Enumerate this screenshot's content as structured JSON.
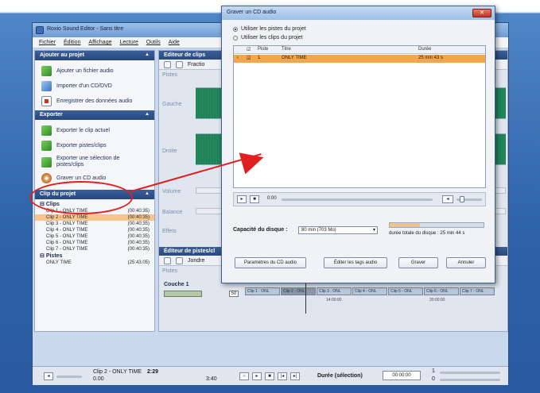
{
  "main_window": {
    "title": "Roxio Sound Editor - Sans titre",
    "menu": [
      "Fichier",
      "Édition",
      "Affichage",
      "Lecture",
      "Outils",
      "Aide"
    ],
    "project_section": {
      "title": "Ajouter au projet",
      "items": [
        "Ajouter un fichier audio",
        "Importer d'un CD/DVD",
        "Enregistrer des données audio"
      ]
    },
    "export_section": {
      "title": "Exporter",
      "items": [
        "Exporter le clip actuel",
        "Exporter pistes/clips",
        "Exporter une sélection de pistes/clips",
        "Graver un CD audio"
      ]
    },
    "project_tree": {
      "title": "Clip du projet",
      "clips_label": "Clips",
      "clips": [
        {
          "name": "Clip 1 - ONLY TIME",
          "time": "(00:40:35)"
        },
        {
          "name": "Clip 2 - ONLY TIME",
          "time": "(00:40:35)"
        },
        {
          "name": "Clip 3 - ONLY TIME",
          "time": "(00:40:35)"
        },
        {
          "name": "Clip 4 - ONLY TIME",
          "time": "(00:40:35)"
        },
        {
          "name": "Clip 5 - ONLY TIME",
          "time": "(00:40:35)"
        },
        {
          "name": "Clip 6 - ONLY TIME",
          "time": "(00:40:35)"
        },
        {
          "name": "Clip 7 - ONLY TIME",
          "time": "(00:40:35)"
        }
      ],
      "selected_clip_index": 1,
      "tracks_label": "Pistes",
      "tracks": [
        {
          "name": "ONLY TIME",
          "time": "(25:43.05)"
        }
      ]
    },
    "clip_editor": {
      "title": "Editeur de clips",
      "tool_label": "Fractio",
      "track_names": [
        "Pistes",
        "Gauche",
        "Droite",
        "Volume",
        "Balance",
        "Effets"
      ]
    },
    "track_editor": {
      "title": "Éditeur de pistes/cl",
      "tool_label": "Jondre",
      "track_header": "Pistes",
      "layer_label": "Couche 1",
      "layer_value": "50",
      "clips": [
        "Clip 1 - ONL",
        "Clip 2 - ONL",
        "Clip 3 - ONL",
        "Clip 4 - ONL",
        "Clip 5 - ONL",
        "Clip 6 - ONL",
        "Clip 7 - ONL"
      ],
      "ruler": [
        "14:00:00",
        "20:00:00"
      ]
    },
    "status": {
      "clip_name": "Clip 2 - ONLY TIME",
      "clip_time": "2:29",
      "position": "0.00",
      "total": "3:40",
      "duration_label": "Durée (sélection)",
      "duration_value": "00:00:00",
      "min_value": "1",
      "max_value": "0"
    }
  },
  "dialog": {
    "title": "Graver un CD audio",
    "radio_options": [
      "Utiliser les pistes du projet",
      "Utiliser les clips du projet"
    ],
    "selected_option": 0,
    "list": {
      "headers": [
        "Piste",
        "Titre",
        "Durée"
      ],
      "rows": [
        {
          "track": "1",
          "title": "ONLY TIME",
          "duration": "25 min 43 s"
        }
      ]
    },
    "player": {
      "time": "0:00"
    },
    "capacity_label": "Capacité du disque :",
    "capacity_value": "80 min (703 Mo)",
    "total_duration": "durée totale du disque : 25 min 44 s",
    "disc_fill_fraction": 0.32,
    "buttons": [
      "Paramètres du CD audio",
      "Éditer les tags audio",
      "Graver",
      "Annuler"
    ]
  }
}
